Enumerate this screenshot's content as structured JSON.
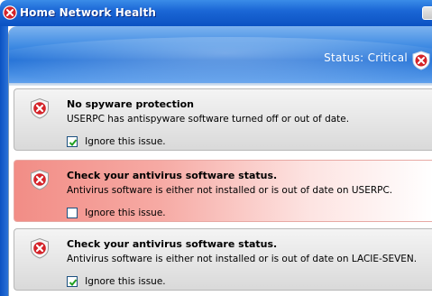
{
  "window": {
    "title": "Home Network Health"
  },
  "header": {
    "status_text": "Status: Critical"
  },
  "issues": [
    {
      "title": "No spyware protection",
      "description": "USERPC has antispyware software turned off or out of date.",
      "ignore_label": "Ignore this issue.",
      "ignored": true,
      "severity": "normal"
    },
    {
      "title": "Check your antivirus software status.",
      "description": "Antivirus software is either not installed or is out of date on USERPC.",
      "ignore_label": "Ignore this issue.",
      "ignored": false,
      "severity": "critical"
    },
    {
      "title": "Check your antivirus software status.",
      "description": "Antivirus software is either not installed or is out of date on LACIE-SEVEN.",
      "ignore_label": "Ignore this issue.",
      "ignored": true,
      "severity": "normal"
    }
  ],
  "icons": {
    "title": "error-shield-icon",
    "status": "critical-shield-icon",
    "issue": "error-shield-icon"
  },
  "colors": {
    "titlebar": "#0b52c2",
    "critical_row": "#f28d86",
    "error_red": "#d4242a"
  }
}
